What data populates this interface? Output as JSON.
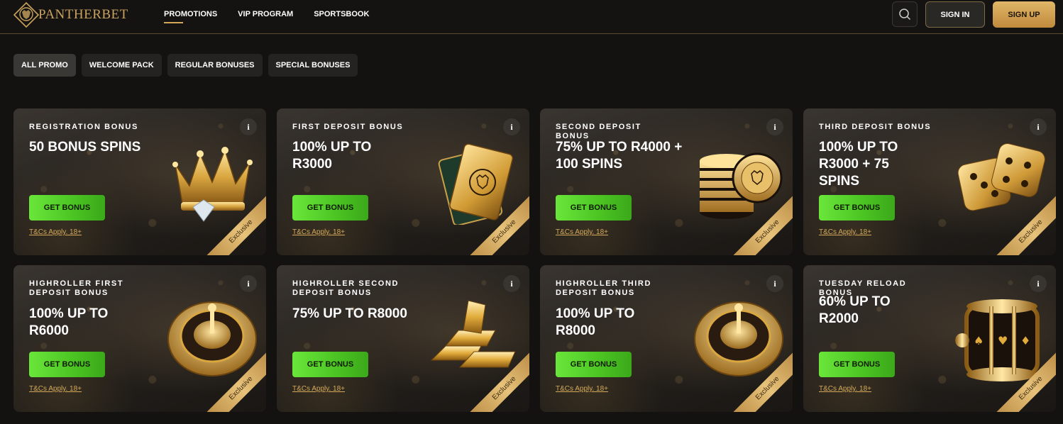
{
  "brand": {
    "name": "PANTHERBET",
    "accent": "#d3a75a",
    "cta_green": "#4ac322"
  },
  "nav": [
    {
      "label": "PROMOTIONS",
      "active": true
    },
    {
      "label": "VIP PROGRAM",
      "active": false
    },
    {
      "label": "SPORTSBOOK",
      "active": false
    }
  ],
  "header": {
    "search_icon": "search-icon",
    "sign_in": "SIGN IN",
    "sign_up": "SIGN UP"
  },
  "tabs": [
    {
      "label": "ALL PROMO",
      "active": true
    },
    {
      "label": "WELCOME PACK",
      "active": false
    },
    {
      "label": "REGULAR BONUSES",
      "active": false
    },
    {
      "label": "SPECIAL BONUSES",
      "active": false
    }
  ],
  "cards": [
    {
      "category": "REGISTRATION BONUS",
      "title": "50 BONUS SPINS",
      "button": "GET BONUS",
      "tcs": "T&Cs Apply. 18+",
      "ribbon": "Exclusive",
      "info": "i",
      "art": "crown"
    },
    {
      "category": "FIRST DEPOSIT BONUS",
      "title": "100% UP TO R3000",
      "button": "GET BONUS",
      "tcs": "T&Cs Apply. 18+",
      "ribbon": "Exclusive",
      "info": "i",
      "art": "cards"
    },
    {
      "category": "SECOND DEPOSIT BONUS",
      "title": "75% UP TO R4000 + 100 SPINS",
      "button": "GET BONUS",
      "tcs": "T&Cs Apply. 18+",
      "ribbon": "Exclusive",
      "info": "i",
      "art": "chips"
    },
    {
      "category": "THIRD DEPOSIT BONUS",
      "title": "100% UP TO R3000 + 75 SPINS",
      "button": "GET BONUS",
      "tcs": "T&Cs Apply. 18+",
      "ribbon": "Exclusive",
      "info": "i",
      "art": "dice"
    },
    {
      "category": "HIGHROLLER FIRST DEPOSIT BONUS",
      "title": "100% UP TO R6000",
      "button": "GET BONUS",
      "tcs": "T&Cs Apply. 18+",
      "ribbon": "Exclusive",
      "info": "i",
      "art": "roulette"
    },
    {
      "category": "HIGHROLLER SECOND DEPOSIT BONUS",
      "title": "75% UP TO R8000",
      "button": "GET BONUS",
      "tcs": "T&Cs Apply. 18+",
      "ribbon": "Exclusive",
      "info": "i",
      "art": "gold-bars"
    },
    {
      "category": "HIGHROLLER THIRD DEPOSIT BONUS",
      "title": "100% UP TO R8000",
      "button": "GET BONUS",
      "tcs": "T&Cs Apply. 18+",
      "ribbon": "Exclusive",
      "info": "i",
      "art": "roulette"
    },
    {
      "category": "TUESDAY RELOAD BONUS",
      "title": "60% UP TO R2000",
      "button": "GET BONUS",
      "tcs": "T&Cs Apply. 18+",
      "ribbon": "Exclusive",
      "info": "i",
      "art": "slot-reels"
    }
  ]
}
